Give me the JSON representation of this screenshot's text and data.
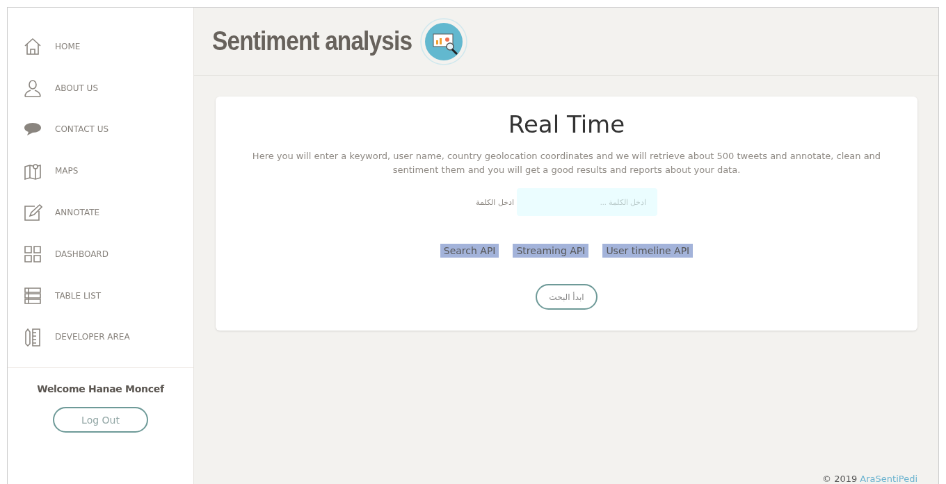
{
  "sidebar": {
    "items": [
      {
        "kind": "home",
        "label": "HOME"
      },
      {
        "kind": "user",
        "label": "ABOUT US"
      },
      {
        "kind": "chat",
        "label": "CONTACT US"
      },
      {
        "kind": "map",
        "label": "MAPS"
      },
      {
        "kind": "edit",
        "label": "ANNOTATE"
      },
      {
        "kind": "grid",
        "label": "DASHBOARD"
      },
      {
        "kind": "list",
        "label": "TABLE LIST"
      },
      {
        "kind": "tools",
        "label": "DEVELOPER AREA"
      }
    ],
    "welcome": "Welcome Hanae Moncef",
    "logout": "Log Out"
  },
  "header": {
    "title": "Sentiment analysis"
  },
  "card": {
    "title": "Real Time",
    "description": "Here you will enter a keyword, user name, country geolocation coordinates and we will retrieve about 500 tweets and annotate, clean and sentiment them and you will get a good results and reports about your data.",
    "field_label": "ادخل الكلمة",
    "field_placeholder": "ادخل الكلمة ...",
    "api_options": [
      "Search API",
      "Streaming API",
      "User timeline API"
    ],
    "submit": "ابدأ البحث"
  },
  "footer": {
    "copyright": "© 2019",
    "link": "AraSentiPedi"
  }
}
